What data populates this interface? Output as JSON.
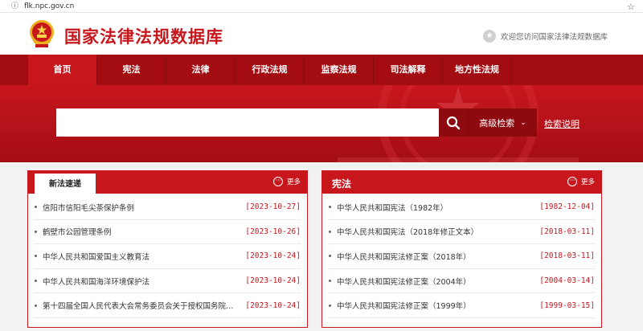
{
  "browser": {
    "url": "flk.npc.gov.cn"
  },
  "header": {
    "site_title": "国家法律法规数据库",
    "welcome": "欢迎您访问国家法律法规数据库"
  },
  "nav": {
    "items": [
      {
        "label": "首页",
        "active": true
      },
      {
        "label": "宪法"
      },
      {
        "label": "法律"
      },
      {
        "label": "行政法规"
      },
      {
        "label": "监察法规"
      },
      {
        "label": "司法解释"
      },
      {
        "label": "地方性法规"
      }
    ]
  },
  "search": {
    "value": "",
    "advanced_label": "高级检索",
    "help_label": "检索说明"
  },
  "panels": {
    "latest": {
      "tab_label": "新法速递",
      "more_label": "更多",
      "items": [
        {
          "title": "信阳市信阳毛尖茶保护条例",
          "date": "[2023-10-27]"
        },
        {
          "title": "鹤壁市公园管理条例",
          "date": "[2023-10-26]"
        },
        {
          "title": "中华人民共和国爱国主义教育法",
          "date": "[2023-10-24]"
        },
        {
          "title": "中华人民共和国海洋环境保护法",
          "date": "[2023-10-24]"
        },
        {
          "title": "第十四届全国人民代表大会常务委员会关于授权国务院…",
          "date": "[2023-10-24]"
        }
      ]
    },
    "constitution": {
      "title": "宪法",
      "more_label": "更多",
      "items": [
        {
          "title": "中华人民共和国宪法（1982年）",
          "date": "[1982-12-04]"
        },
        {
          "title": "中华人民共和国宪法（2018年修正文本）",
          "date": "[2018-03-11]"
        },
        {
          "title": "中华人民共和国宪法修正案（2018年）",
          "date": "[2018-03-11]"
        },
        {
          "title": "中华人民共和国宪法修正案（2004年）",
          "date": "[2004-03-14]"
        },
        {
          "title": "中华人民共和国宪法修正案（1999年）",
          "date": "[1999-03-15]"
        }
      ]
    }
  },
  "colors": {
    "brand_red": "#c8161d",
    "nav_red": "#a30d12",
    "dark_red": "#8e0a0f"
  }
}
